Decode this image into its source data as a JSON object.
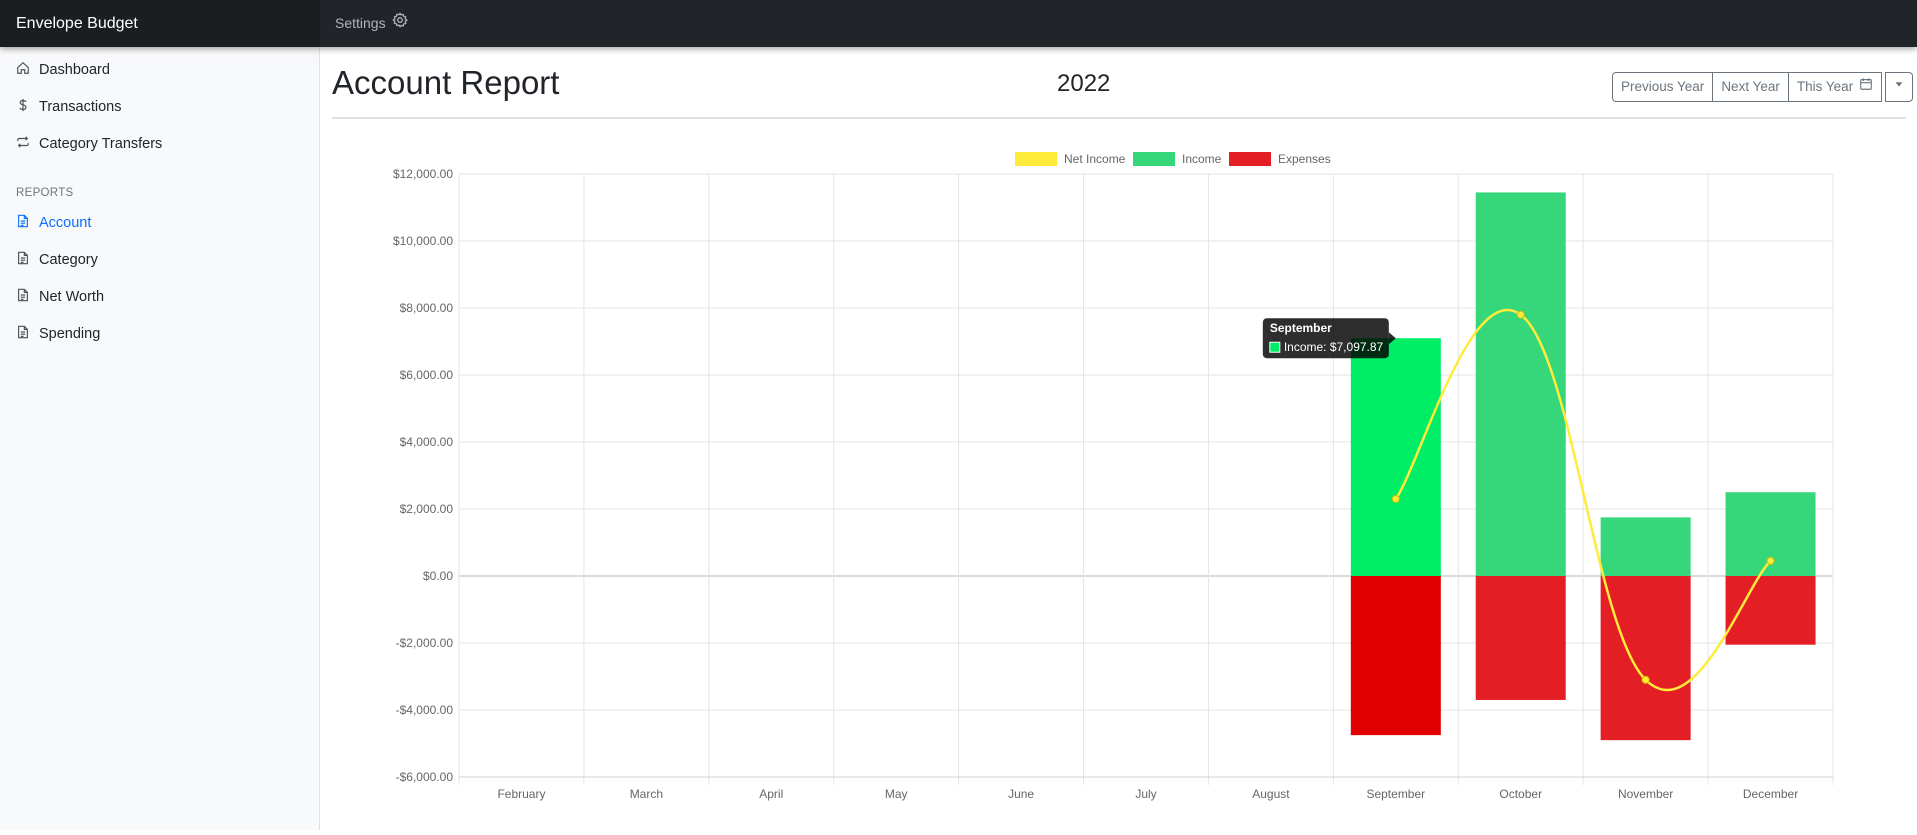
{
  "app": {
    "brand": "Envelope Budget",
    "settings_label": "Settings"
  },
  "sidebar": {
    "items": [
      {
        "label": "Dashboard",
        "icon": "home-icon"
      },
      {
        "label": "Transactions",
        "icon": "dollar-icon"
      },
      {
        "label": "Category Transfers",
        "icon": "transfer-icon"
      }
    ],
    "reports_heading": "REPORTS",
    "reports": [
      {
        "label": "Account",
        "icon": "document-icon",
        "active": true
      },
      {
        "label": "Category",
        "icon": "document-icon"
      },
      {
        "label": "Net Worth",
        "icon": "document-icon"
      },
      {
        "label": "Spending",
        "icon": "document-icon"
      }
    ],
    "active_color": "#0d6efd"
  },
  "page": {
    "title": "Account Report",
    "year": "2022",
    "buttons": {
      "previous": "Previous Year",
      "next": "Next Year",
      "this_year": "This Year"
    }
  },
  "chart_data": {
    "type": "bar",
    "categories": [
      "February",
      "March",
      "April",
      "May",
      "June",
      "July",
      "August",
      "September",
      "October",
      "November",
      "December"
    ],
    "series": [
      {
        "name": "Net Income",
        "type": "line",
        "color": "#ffeb3b",
        "values": [
          null,
          null,
          null,
          null,
          null,
          null,
          null,
          2300,
          7800,
          -3100,
          450
        ]
      },
      {
        "name": "Income",
        "type": "bar",
        "color": "#36d67a",
        "values": [
          null,
          null,
          null,
          null,
          null,
          null,
          null,
          7097.87,
          11450,
          1750,
          2500
        ]
      },
      {
        "name": "Expenses",
        "type": "bar",
        "color": "#e31e24",
        "values": [
          null,
          null,
          null,
          null,
          null,
          null,
          null,
          -4750,
          -3700,
          -4900,
          -2050
        ]
      }
    ],
    "ylim": [
      -6000,
      12000
    ],
    "yticks": [
      "$12,000.00",
      "$10,000.00",
      "$8,000.00",
      "$6,000.00",
      "$4,000.00",
      "$2,000.00",
      "$0.00",
      "-$2,000.00",
      "-$4,000.00",
      "-$6,000.00"
    ],
    "ytick_values": [
      12000,
      10000,
      8000,
      6000,
      4000,
      2000,
      0,
      -2000,
      -4000,
      -6000
    ],
    "legend_position": "top-center",
    "grid": true,
    "hovered": {
      "category": "September",
      "series": "Income",
      "highlight_income": "#00ee66",
      "highlight_expense": "#e00000"
    },
    "tooltip": {
      "title": "September",
      "text": "Income: $7,097.87"
    }
  }
}
